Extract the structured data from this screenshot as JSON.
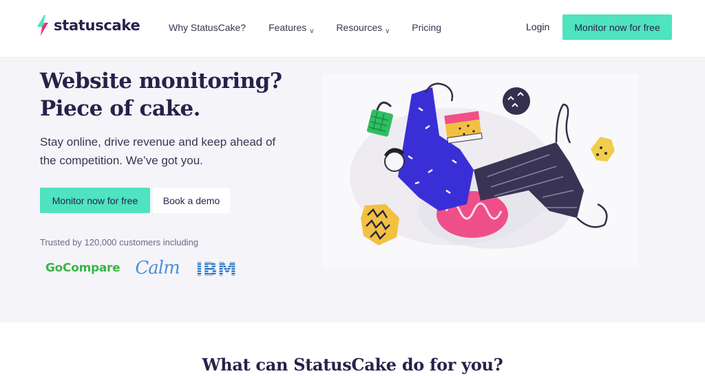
{
  "nav": {
    "logo_text": "statuscake",
    "links": [
      {
        "label": "Why StatusCake?",
        "has_dropdown": false
      },
      {
        "label": "Features",
        "has_dropdown": true
      },
      {
        "label": "Resources",
        "has_dropdown": true
      },
      {
        "label": "Pricing",
        "has_dropdown": false
      }
    ],
    "dropdown_glyph": "v",
    "login_label": "Login",
    "cta_label": "Monitor now for free"
  },
  "hero": {
    "headline_line1": "Website monitoring?",
    "headline_line2": "Piece of cake.",
    "subtitle_line1": "Stay online, drive revenue and keep ahead of",
    "subtitle_line2": "the competition. We’ve got you.",
    "primary_cta": "Monitor now for free",
    "secondary_cta": "Book a demo",
    "trusted_text": "Trusted by 120,000 customers including",
    "customer_logos": [
      "GoCompare",
      "Calm",
      "IBM"
    ]
  },
  "section": {
    "title": "What can StatusCake do for you?"
  },
  "colors": {
    "accent": "#4fe3c0",
    "brand_dark": "#27224a",
    "hero_bg": "#f5f4f8"
  }
}
